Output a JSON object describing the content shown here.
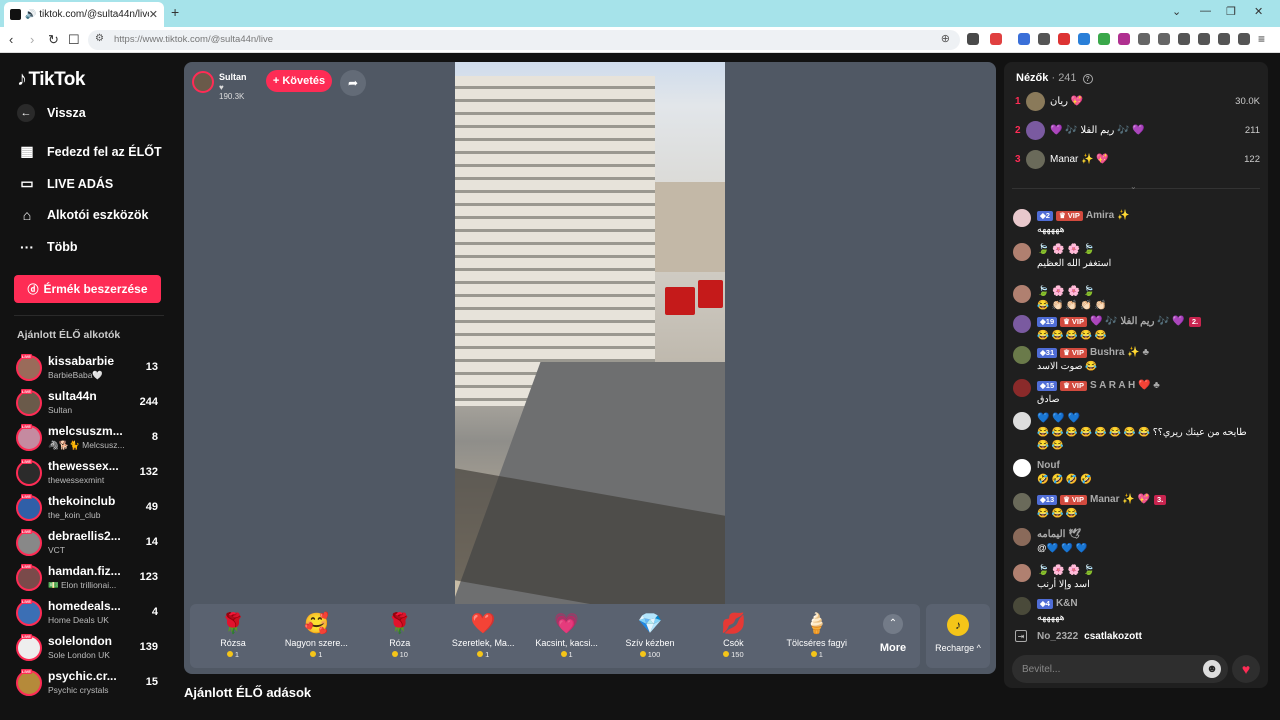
{
  "browser": {
    "tab_title": "tiktok.com/@sulta44n/live",
    "tab_close": "✕",
    "new_tab": "+",
    "url": "https://www.tiktok.com/@sulta44n/live"
  },
  "sidebar": {
    "logo": "TikTok",
    "back": "Vissza",
    "nav": [
      {
        "label": "Fedezd fel az ÉLŐT",
        "icon": "calendar-icon"
      },
      {
        "label": "LIVE ADÁS",
        "icon": "video-camera-icon"
      },
      {
        "label": "Alkotói eszközök",
        "icon": "home-tools-icon"
      },
      {
        "label": "Több",
        "icon": "more-dots-icon"
      }
    ],
    "coins_button": "Érmék beszerzése",
    "recommended_title": "Ajánlott ÉLŐ alkotók",
    "creators": [
      {
        "name": "kissabarbie",
        "sub": "BarbieBaba🤍",
        "count": "13",
        "color": "#9a6b5a"
      },
      {
        "name": "sulta44n",
        "sub": "Sultan",
        "count": "244",
        "color": "#6a5a4a"
      },
      {
        "name": "melcsuszm...",
        "sub": "🦓🐕🐈 Melcsusz...",
        "count": "8",
        "color": "#c58aa0"
      },
      {
        "name": "thewessex...",
        "sub": "thewessexmint",
        "count": "132",
        "color": "#2b2b2b"
      },
      {
        "name": "thekoinclub",
        "sub": "the_koin_club",
        "count": "49",
        "color": "#2f5fa8"
      },
      {
        "name": "debraellis2...",
        "sub": "VCT",
        "count": "14",
        "color": "#888"
      },
      {
        "name": "hamdan.fiz...",
        "sub": "💵 Elon trillionai...",
        "count": "123",
        "color": "#7a4a4a"
      },
      {
        "name": "homedeals...",
        "sub": "Home Deals UK",
        "count": "4",
        "color": "#3b6fb5"
      },
      {
        "name": "solelondon",
        "sub": "Sole London UK",
        "count": "139",
        "color": "#eee"
      },
      {
        "name": "psychic.cr...",
        "sub": "Psychic crystals",
        "count": "15",
        "color": "#b58a3a"
      }
    ]
  },
  "stream": {
    "streamer_name": "Sultan",
    "likes": "190.3K",
    "follow": "+ Követés"
  },
  "gifts": [
    {
      "name": "Rózsa",
      "price": "1",
      "icon": "🌹"
    },
    {
      "name": "Nagyon szere...",
      "price": "1",
      "icon": "🥰"
    },
    {
      "name": "Róza",
      "price": "10",
      "icon": "🌹"
    },
    {
      "name": "Szeretlek, Ma...",
      "price": "1",
      "icon": "❤️"
    },
    {
      "name": "Kacsint, kacsi...",
      "price": "1",
      "icon": "💗"
    },
    {
      "name": "Szív kézben",
      "price": "100",
      "icon": "💎"
    },
    {
      "name": "Csók",
      "price": "150",
      "icon": "💋"
    },
    {
      "name": "Tölcséres fagyi",
      "price": "1",
      "icon": "🍦"
    }
  ],
  "more_label": "More",
  "recharge_label": "Recharge ^",
  "recommended_lives": "Ajánlott ÉLŐ adások",
  "viewers": {
    "label": "Nézők",
    "count": "· 241",
    "top": [
      {
        "rank": "1",
        "name": "ريان 💖",
        "score": "30.0K",
        "color": "#8a7a5a"
      },
      {
        "rank": "2",
        "name": "💜 🎶 ريم الفلا 🎶 💜",
        "score": "211",
        "color": "#7a5aa0"
      },
      {
        "rank": "3",
        "name": "Manar ✨ 💖",
        "score": "122",
        "color": "#6a6a5a"
      }
    ]
  },
  "chat": [
    {
      "badges": [
        "lvl:2",
        "vip:VIP"
      ],
      "user": "Amira ✨",
      "text": "هههههه",
      "color": "#e8c8cc"
    },
    {
      "badges": [],
      "user": "🍃 🌸 🌸 🍃",
      "text": "استغفر الله العظيم",
      "color": "#b08070"
    },
    {
      "badges": [],
      "user": "🍃 🌸 🌸 🍃",
      "text": "😂 👏🏻 👏🏻 👏🏻 👏🏻",
      "color": "#b08070"
    },
    {
      "badges": [
        "lvl:19",
        "vip:VIP"
      ],
      "user": "💜 🎶 ريم الفلا 🎶 💜 ",
      "text": "😂 😂 😂 😂 😂",
      "fan": "2.",
      "color": "#7a5aa0"
    },
    {
      "badges": [
        "lvl:31",
        "vip:VIP"
      ],
      "user": "Bushra ✨ ♣",
      "text": "صوت الاسد 😂",
      "color": "#6a7a4a"
    },
    {
      "badges": [
        "lvl:15",
        "vip:VIP"
      ],
      "user": "S A R A H ❤️ ♣",
      "text": "صادق",
      "color": "#8a2a2a"
    },
    {
      "badges": [],
      "user": "💙 💙 💙",
      "text": "😂 😂 😂 😂 😂 😂 😂 😂 طايحه من عينك ريري؟؟",
      "text2": "😂 😂",
      "color": "#ddd"
    },
    {
      "badges": [],
      "user": "Nouf",
      "text": "🤣 🤣 🤣 🤣",
      "color": "#fff"
    },
    {
      "badges": [
        "lvl:13",
        "vip:VIP"
      ],
      "user": "Manar ✨ 💖",
      "text": "😂 😂 😂",
      "fan": "3.",
      "color": "#6a6a5a"
    },
    {
      "badges": [],
      "user": "اليمامه 🕊",
      "text": "@💙 💙 💙",
      "color": "#8a6a5a"
    },
    {
      "badges": [],
      "user": "🍃 🌸 🌸 🍃",
      "text": "اسد وإلا أرنب",
      "color": "#b08070"
    },
    {
      "badges": [
        "lvl:4"
      ],
      "user": "K&N",
      "text": "هههههه",
      "color": "#4a4a3a"
    }
  ],
  "join": {
    "user": "No_2322",
    "text": "csatlakozott"
  },
  "input_placeholder": "Bevitel..."
}
